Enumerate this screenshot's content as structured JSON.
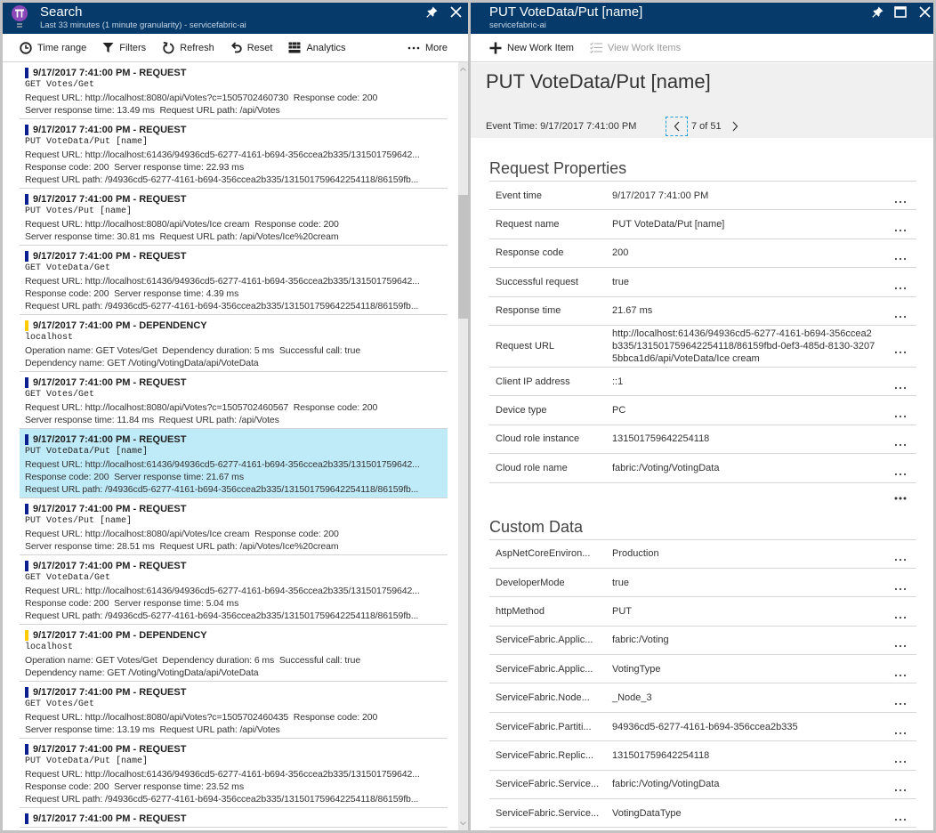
{
  "colors": {
    "header_bg": "#053a6b",
    "request_marker": "#0b1f8e",
    "dependency_marker": "#ffcb05",
    "selected_bg": "#bfeaf7",
    "focus_outline": "#1e9bd7"
  },
  "left_panel": {
    "header": {
      "title": "Search",
      "subtitle": "Last 33 minutes (1 minute granularity) - servicefabric-ai"
    },
    "toolbar": [
      {
        "label": "Time range",
        "icon": "clock-icon"
      },
      {
        "label": "Filters",
        "icon": "filter-icon"
      },
      {
        "label": "Refresh",
        "icon": "refresh-icon"
      },
      {
        "label": "Reset",
        "icon": "reset-icon"
      },
      {
        "label": "Analytics",
        "icon": "analytics-icon"
      }
    ],
    "more": {
      "label": "More",
      "icon": "more-icon"
    },
    "results": [
      {
        "kind": "request",
        "header": "9/17/2017 7:41:00 PM - REQUEST",
        "name": "GET Votes/Get",
        "details": [
          "Request URL: http://localhost:8080/api/Votes?c=1505702460730  Response code: 200",
          "Server response time: 13.49 ms  Request URL path: /api/Votes"
        ]
      },
      {
        "kind": "request",
        "header": "9/17/2017 7:41:00 PM - REQUEST",
        "name": "PUT VoteData/Put [name]",
        "details": [
          "Request URL: http://localhost:61436/94936cd5-6277-4161-b694-356ccea2b335/131501759642...",
          "Response code: 200  Server response time: 22.93 ms",
          "Request URL path: /94936cd5-6277-4161-b694-356ccea2b335/131501759642254118/86159fb..."
        ]
      },
      {
        "kind": "request",
        "header": "9/17/2017 7:41:00 PM - REQUEST",
        "name": "PUT Votes/Put [name]",
        "details": [
          "Request URL: http://localhost:8080/api/Votes/Ice cream  Response code: 200",
          "Server response time: 30.81 ms  Request URL path: /api/Votes/Ice%20cream"
        ]
      },
      {
        "kind": "request",
        "header": "9/17/2017 7:41:00 PM - REQUEST",
        "name": "GET VoteData/Get",
        "details": [
          "Request URL: http://localhost:61436/94936cd5-6277-4161-b694-356ccea2b335/131501759642...",
          "Response code: 200  Server response time: 4.39 ms",
          "Request URL path: /94936cd5-6277-4161-b694-356ccea2b335/131501759642254118/86159fb..."
        ]
      },
      {
        "kind": "dependency",
        "header": "9/17/2017 7:41:00 PM - DEPENDENCY",
        "name": "localhost",
        "details": [
          "Operation name: GET Votes/Get  Dependency duration: 5 ms  Successful call: true",
          "Dependency name: GET /Voting/VotingData/api/VoteData"
        ]
      },
      {
        "kind": "request",
        "header": "9/17/2017 7:41:00 PM - REQUEST",
        "name": "GET Votes/Get",
        "details": [
          "Request URL: http://localhost:8080/api/Votes?c=1505702460567  Response code: 200",
          "Server response time: 11.84 ms  Request URL path: /api/Votes"
        ]
      },
      {
        "kind": "request",
        "header": "9/17/2017 7:41:00 PM - REQUEST",
        "name": "PUT VoteData/Put [name]",
        "selected": true,
        "details": [
          "Request URL: http://localhost:61436/94936cd5-6277-4161-b694-356ccea2b335/131501759642...",
          "Response code: 200  Server response time: 21.67 ms",
          "Request URL path: /94936cd5-6277-4161-b694-356ccea2b335/131501759642254118/86159fb..."
        ]
      },
      {
        "kind": "request",
        "header": "9/17/2017 7:41:00 PM - REQUEST",
        "name": "PUT Votes/Put [name]",
        "details": [
          "Request URL: http://localhost:8080/api/Votes/Ice cream  Response code: 200",
          "Server response time: 28.51 ms  Request URL path: /api/Votes/Ice%20cream"
        ]
      },
      {
        "kind": "request",
        "header": "9/17/2017 7:41:00 PM - REQUEST",
        "name": "GET VoteData/Get",
        "details": [
          "Request URL: http://localhost:61436/94936cd5-6277-4161-b694-356ccea2b335/131501759642...",
          "Response code: 200  Server response time: 5.04 ms",
          "Request URL path: /94936cd5-6277-4161-b694-356ccea2b335/131501759642254118/86159fb..."
        ]
      },
      {
        "kind": "dependency",
        "header": "9/17/2017 7:41:00 PM - DEPENDENCY",
        "name": "localhost",
        "details": [
          "Operation name: GET Votes/Get  Dependency duration: 6 ms  Successful call: true",
          "Dependency name: GET /Voting/VotingData/api/VoteData"
        ]
      },
      {
        "kind": "request",
        "header": "9/17/2017 7:41:00 PM - REQUEST",
        "name": "GET Votes/Get",
        "details": [
          "Request URL: http://localhost:8080/api/Votes?c=1505702460435  Response code: 200",
          "Server response time: 13.19 ms  Request URL path: /api/Votes"
        ]
      },
      {
        "kind": "request",
        "header": "9/17/2017 7:41:00 PM - REQUEST",
        "name": "PUT VoteData/Put [name]",
        "details": [
          "Request URL: http://localhost:61436/94936cd5-6277-4161-b694-356ccea2b335/131501759642...",
          "Response code: 200  Server response time: 23.52 ms",
          "Request URL path: /94936cd5-6277-4161-b694-356ccea2b335/131501759642254118/86159fb..."
        ]
      },
      {
        "kind": "request",
        "header": "9/17/2017 7:41:00 PM - REQUEST"
      }
    ]
  },
  "right_panel": {
    "header": {
      "title": "PUT VoteData/Put [name]",
      "subtitle": "servicefabric-ai"
    },
    "toolbar": {
      "new_work_item": "New Work Item",
      "view_work_items": "View Work Items"
    },
    "detail_title": "PUT VoteData/Put [name]",
    "event_time": "Event Time: 9/17/2017 7:41:00 PM",
    "pager": {
      "label": "7 of 51"
    },
    "request_properties": {
      "heading": "Request Properties",
      "rows": [
        {
          "label": "Event time",
          "value": "9/17/2017 7:41:00 PM"
        },
        {
          "label": "Request name",
          "value": "PUT VoteData/Put [name]"
        },
        {
          "label": "Response code",
          "value": "200"
        },
        {
          "label": "Successful request",
          "value": "true"
        },
        {
          "label": "Response time",
          "value": "21.67 ms"
        },
        {
          "label": "Request URL",
          "value": "http://localhost:61436/94936cd5-6277-4161-b694-356ccea2b335/131501759642254118/86159fbd-0ef3-485d-8130-32075bbca1d6/api/VoteData/Ice cream"
        },
        {
          "label": "Client IP address",
          "value": "::1"
        },
        {
          "label": "Device type",
          "value": "PC"
        },
        {
          "label": "Cloud role instance",
          "value": "131501759642254118"
        },
        {
          "label": "Cloud role name",
          "value": "fabric:/Voting/VotingData"
        }
      ]
    },
    "custom_data": {
      "heading": "Custom Data",
      "rows": [
        {
          "label": "AspNetCoreEnviron...",
          "value": "Production"
        },
        {
          "label": "DeveloperMode",
          "value": "true"
        },
        {
          "label": "httpMethod",
          "value": "PUT"
        },
        {
          "label": "ServiceFabric.Applic...",
          "value": "fabric:/Voting"
        },
        {
          "label": "ServiceFabric.Applic...",
          "value": "VotingType"
        },
        {
          "label": "ServiceFabric.Node...",
          "value": "_Node_3"
        },
        {
          "label": "ServiceFabric.Partiti...",
          "value": "94936cd5-6277-4161-b694-356ccea2b335"
        },
        {
          "label": "ServiceFabric.Replic...",
          "value": "131501759642254118"
        },
        {
          "label": "ServiceFabric.Service...",
          "value": "fabric:/Voting/VotingData"
        },
        {
          "label": "ServiceFabric.Service...",
          "value": "VotingDataType"
        }
      ]
    }
  }
}
